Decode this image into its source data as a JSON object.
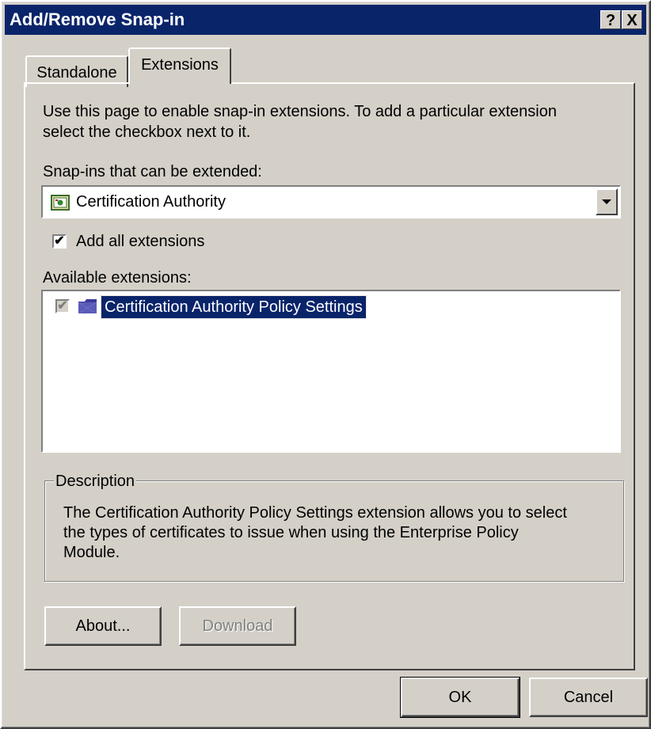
{
  "window": {
    "title": "Add/Remove Snap-in",
    "help_button": "?",
    "close_button": "X"
  },
  "tabs": [
    {
      "label": "Standalone",
      "active": false
    },
    {
      "label": "Extensions",
      "active": true
    }
  ],
  "extensions_page": {
    "intro_line1": "Use this page to enable snap-in extensions. To add a particular extension",
    "intro_line2": "select the checkbox next to it.",
    "snapins_label": "Snap-ins that can be extended:",
    "snapins_selected": "Certification Authority",
    "add_all_label": "Add all extensions",
    "add_all_checked": true,
    "available_label": "Available extensions:",
    "available_items": [
      {
        "label": "Certification Authority Policy Settings",
        "checked": true,
        "disabled": true,
        "selected": true
      }
    ],
    "description_legend": "Description",
    "description_line1": "The Certification Authority Policy Settings extension allows you to select",
    "description_line2": "the types of certificates to issue when using the Enterprise Policy",
    "description_line3": "Module.",
    "about_button": "About...",
    "download_button": "Download"
  },
  "footer": {
    "ok_button": "OK",
    "cancel_button": "Cancel"
  },
  "colors": {
    "titlebar": "#0a246a",
    "face": "#d4d0c8",
    "selection": "#0a246a"
  }
}
